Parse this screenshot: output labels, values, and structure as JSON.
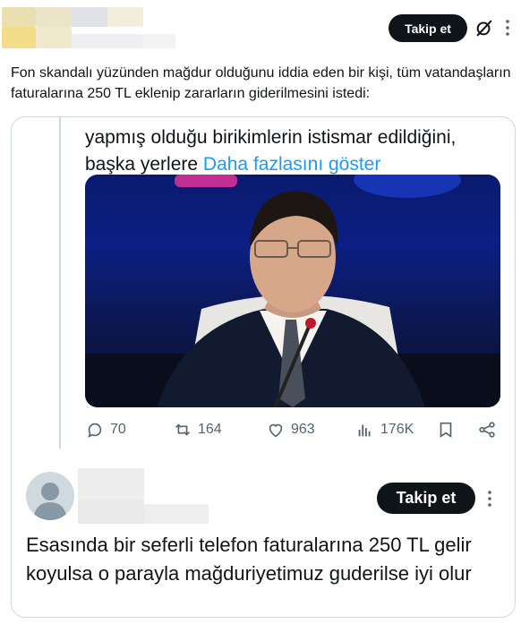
{
  "header": {
    "follow_label": "Takip et",
    "grok_icon": "grok-icon",
    "more_icon": "more-icon"
  },
  "tweet": {
    "text": "Fon skandalı yüzünden mağdur olduğunu iddia eden bir kişi, tüm vatandaşların faturalarına 250 TL eklenip zararların giderilmesini istedi:"
  },
  "quoted": {
    "text_line1": "yapmış olduğu birikimlerin istismar edildiğini,",
    "text_line2_prefix": "başka yerlere",
    "show_more": "Daha fazlasını göster",
    "photo_icon": "photo",
    "stats": {
      "replies": "70",
      "retweets": "164",
      "likes": "963",
      "views": "176K"
    },
    "icons": {
      "reply": "reply-icon",
      "retweet": "retweet-icon",
      "like": "heart-icon",
      "views": "views-icon",
      "bookmark": "bookmark-icon",
      "share": "share-icon"
    }
  },
  "reply": {
    "follow_label": "Takip et",
    "text": "Esasında bir seferli telefon faturalarına 250 TL gelir koyulsa o parayla mağduriyetimuz guderilse iyi olur"
  },
  "colors": {
    "link": "#1d9bf0",
    "button_bg": "#0f1419",
    "muted": "#536471",
    "border": "#cfd9de"
  }
}
